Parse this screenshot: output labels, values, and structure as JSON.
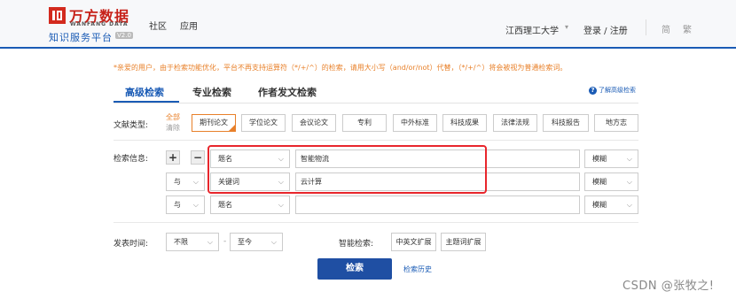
{
  "header": {
    "logo_cn": "万方数据",
    "logo_en": "WANFANG DATA",
    "subtitle": "知识服务平台",
    "version": "V2.0",
    "nav": [
      "社区",
      "应用"
    ],
    "institution": "江西理工大学",
    "login": "登录 / 注册",
    "lang_simplified": "简",
    "lang_traditional": "繁"
  },
  "notice": "*亲爱的用户，由于检索功能优化，平台不再支持运算符（*/+/^）的检索，请用大小写（and/or/not）代替，（*/+/^）将会被视为普通检索词。",
  "tabs": {
    "advanced": "高级检索",
    "professional": "专业检索",
    "author": "作者发文检索",
    "help": "了解高级检索"
  },
  "doc_type": {
    "label": "文献类型:",
    "select_all": "全部",
    "clear": "清除",
    "types": [
      "期刊论文",
      "学位论文",
      "会议论文",
      "专利",
      "中外标准",
      "科技成果",
      "法律法规",
      "科技报告",
      "地方志"
    ]
  },
  "search_info": {
    "label": "检索信息:",
    "add": "+",
    "remove": "−",
    "rows": [
      {
        "logic": "",
        "field": "题名",
        "value": "智能物流",
        "match": "模糊"
      },
      {
        "logic": "与",
        "field": "关键词",
        "value": "云计算",
        "match": "模糊"
      },
      {
        "logic": "与",
        "field": "题名",
        "value": "",
        "match": "模糊"
      }
    ]
  },
  "publish_time": {
    "label": "发表时间:",
    "from": "不限",
    "dash": "-",
    "to": "至今"
  },
  "smart": {
    "label": "智能检索:",
    "cn_en": "中英文扩展",
    "topic": "主题词扩展"
  },
  "actions": {
    "search": "检索",
    "history": "检索历史"
  },
  "watermark": "CSDN @张牧之!",
  "colors": {
    "primary": "#1a5bb5",
    "button": "#1f4fa3",
    "accent": "#e8802a",
    "highlight": "#e8262c"
  }
}
